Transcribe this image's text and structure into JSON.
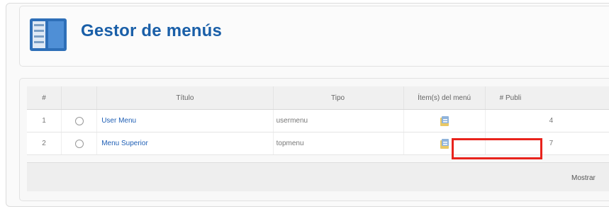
{
  "header": {
    "title": "Gestor de menús",
    "icon": "menu-manager-icon"
  },
  "table": {
    "columns": [
      "#",
      "Título",
      "Tipo",
      "Ítem(s) del menú",
      "# Publi"
    ],
    "rows": [
      {
        "num": "1",
        "title": "User Menu",
        "type": "usermenu",
        "items_icon": "menu-items-icon",
        "published": "4"
      },
      {
        "num": "2",
        "title": "Menu Superior",
        "type": "topmenu",
        "items_icon": "menu-items-icon",
        "published": "7"
      }
    ]
  },
  "footer": {
    "display_label": "Mostrar"
  },
  "colors": {
    "title_blue": "#1a5fa8",
    "link_blue": "#1f5fb5",
    "highlight_red": "#e8231c"
  }
}
